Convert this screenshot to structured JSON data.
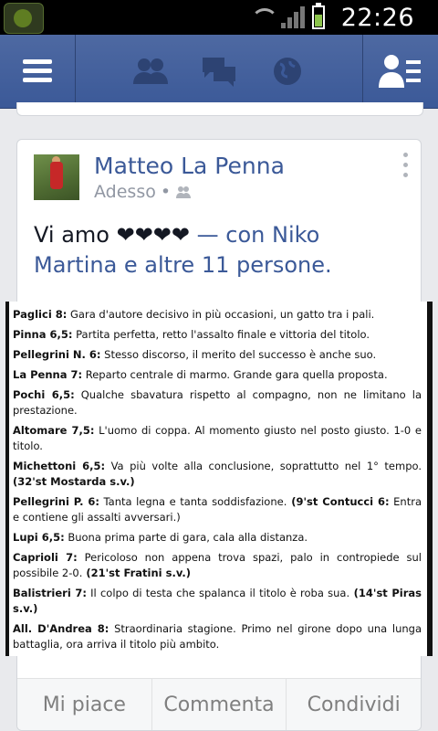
{
  "status_bar": {
    "time": "22:26",
    "icons": [
      "app-icon",
      "wifi-icon",
      "signal-icon",
      "battery-icon"
    ]
  },
  "nav": {
    "icons": [
      "menu-icon",
      "friend-requests-icon",
      "messages-icon",
      "notifications-globe-icon",
      "people-list-icon"
    ]
  },
  "post": {
    "author": "Matteo La Penna",
    "timestamp": "Adesso",
    "privacy_icon": "friends-icon",
    "text": "Vi amo ❤❤❤❤",
    "with_prefix": " — con ",
    "tagged": "Niko Martina e altre 11 persone.",
    "clipping": [
      {
        "name": "Paglici 8:",
        "text": " Gara d'autore decisivo in più occasioni, un gatto tra i pali."
      },
      {
        "name": "Pinna 6,5:",
        "text": " Partita perfetta, retto l'assalto finale e vittoria del titolo."
      },
      {
        "name": "Pellegrini N. 6:",
        "text": " Stesso discorso, il merito del successo è anche suo."
      },
      {
        "name": "La Penna 7:",
        "text": " Reparto centrale di marmo. Grande gara quella proposta."
      },
      {
        "name": "Pochi 6,5:",
        "text": " Qualche sbavatura rispetto al compagno, non ne limitano la prestazione."
      },
      {
        "name": "Altomare 7,5:",
        "text": " L'uomo di coppa. Al momento giusto nel posto giusto. 1-0 e titolo."
      },
      {
        "name": "Michettoni 6,5:",
        "text": " Va più volte alla conclusione, soprattutto nel 1° tempo.",
        "sub": " (32'st Mostarda s.v.)"
      },
      {
        "name": "Pellegrini P. 6:",
        "text": " Tanta legna e tanta soddisfazione.",
        "sub": " (9'st Contucci 6:",
        "tail": " Entra e contiene gli assalti avversari.)"
      },
      {
        "name": "Lupi 6,5:",
        "text": " Buona prima parte di gara, cala alla distanza."
      },
      {
        "name": "Caprioli 7:",
        "text": " Pericoloso non appena trova spazi, palo in contropiede sul possibile 2-0.",
        "sub": " (21'st Fratini s.v.)"
      },
      {
        "name": "Balistrieri 7:",
        "text": " Il colpo di testa che spalanca il titolo è roba sua.",
        "sub": " (14'st Piras s.v.)"
      },
      {
        "name": "All. D'Andrea 8:",
        "text": " Straordinaria stagione. Primo nel girone dopo una lunga battaglia, ora arriva il titolo più ambito."
      }
    ],
    "actions": {
      "like": "Mi piace",
      "comment": "Commenta",
      "share": "Condividi"
    }
  },
  "colors": {
    "brand": "#3b5998",
    "background": "#e9eaed"
  }
}
